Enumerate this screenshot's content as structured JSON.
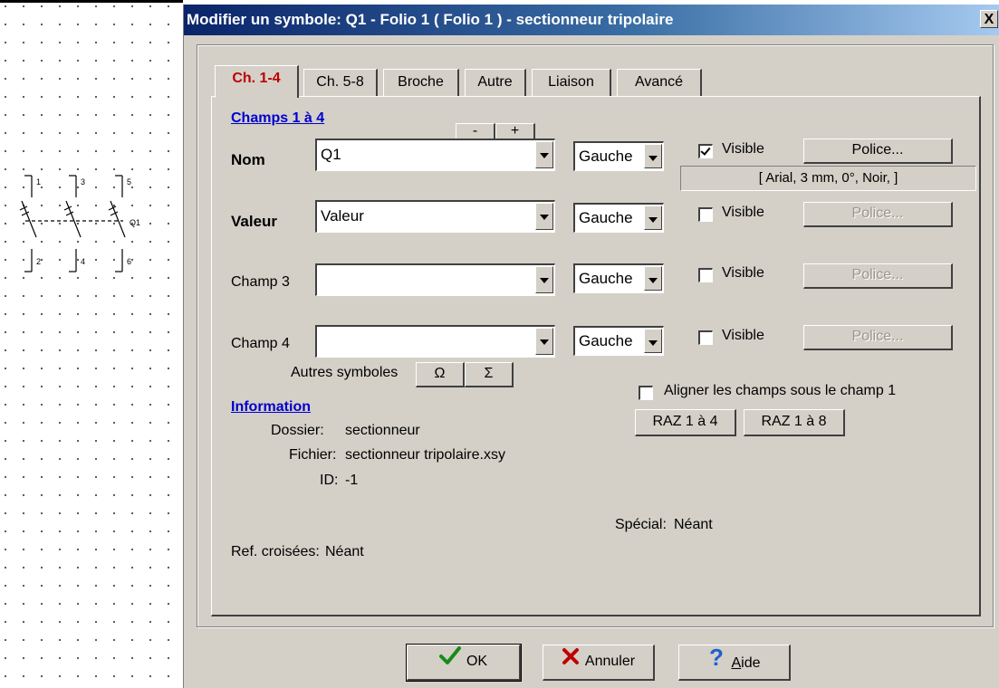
{
  "canvas": {
    "pin_numbers": [
      "1",
      "3",
      "5",
      "2",
      "4",
      "6"
    ],
    "component_label": "Q1"
  },
  "dialog": {
    "title": "Modifier un symbole: Q1 - Folio 1 ( Folio 1 ) - sectionneur tripolaire",
    "close_glyph": "X",
    "tabs": [
      {
        "label": "Ch. 1-4",
        "active": true
      },
      {
        "label": "Ch. 5-8",
        "active": false
      },
      {
        "label": "Broche",
        "active": false
      },
      {
        "label": "Autre",
        "active": false
      },
      {
        "label": "Liaison",
        "active": false
      },
      {
        "label": "Avancé",
        "active": false
      }
    ],
    "fields_section": {
      "heading": "Champs 1 à 4",
      "minus_label": "-",
      "plus_label": "+",
      "rows": [
        {
          "label": "Nom",
          "bold": true,
          "value": "Q1",
          "align": "Gauche",
          "visible_label": "Visible",
          "visible_checked": true,
          "font_button": "Police...",
          "font_enabled": true
        },
        {
          "label": "Valeur",
          "bold": true,
          "value": "Valeur",
          "align": "Gauche",
          "visible_label": "Visible",
          "visible_checked": false,
          "font_button": "Police...",
          "font_enabled": false
        },
        {
          "label": "Champ 3",
          "bold": false,
          "value": "",
          "align": "Gauche",
          "visible_label": "Visible",
          "visible_checked": false,
          "font_button": "Police...",
          "font_enabled": false
        },
        {
          "label": "Champ 4",
          "bold": false,
          "value": "",
          "align": "Gauche",
          "visible_label": "Visible",
          "visible_checked": false,
          "font_button": "Police...",
          "font_enabled": false
        }
      ],
      "font_info": "[ Arial, 3 mm, 0°, Noir,  ]",
      "other_symbols_label": "Autres symboles",
      "omega_label": "Ω",
      "sigma_label": "Σ",
      "align_fields_label": "Aligner les champs sous le champ 1",
      "align_fields_checked": false,
      "reset_1_4_label": "RAZ 1 à 4",
      "reset_1_8_label": "RAZ 1 à 8"
    },
    "information": {
      "heading": "Information",
      "dossier_label": "Dossier:",
      "dossier_value": "sectionneur",
      "fichier_label": "Fichier:",
      "fichier_value": "sectionneur tripolaire.xsy",
      "id_label": "ID:",
      "id_value": "-1",
      "special_label": "Spécial:",
      "special_value": "Néant",
      "ref_label": "Ref. croisées:",
      "ref_value": "Néant"
    },
    "buttons": {
      "ok": "OK",
      "cancel": "Annuler",
      "help_underlined": "A",
      "help_rest": "ide"
    }
  }
}
